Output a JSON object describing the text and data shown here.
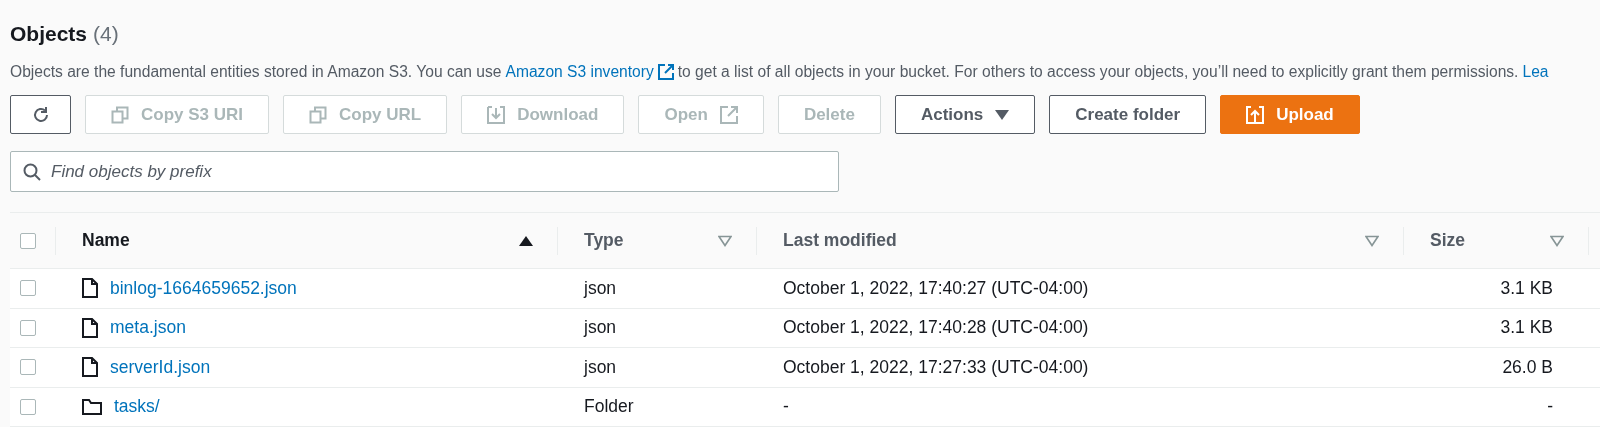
{
  "header": {
    "title": "Objects",
    "count": "(4)"
  },
  "description": {
    "text": "Objects are the fundamental entities stored in Amazon S3. You can use",
    "link": "Amazon S3 inventory",
    "after": "to get a list of all objects in your bucket. For others to access your objects, you’ll need to explicitly grant them permissions.",
    "more": "Lea"
  },
  "toolbar": [
    {
      "kind": "refresh",
      "disabled": false,
      "primary": false
    },
    {
      "kind": "copy",
      "label": "Copy S3 URI",
      "disabled": true,
      "primary": false
    },
    {
      "kind": "copy",
      "label": "Copy URL",
      "disabled": true,
      "primary": false
    },
    {
      "kind": "download",
      "label": "Download",
      "disabled": true,
      "primary": false
    },
    {
      "kind": "open",
      "label": "Open",
      "disabled": true,
      "primary": false
    },
    {
      "kind": "plain",
      "label": "Delete",
      "disabled": true,
      "primary": false
    },
    {
      "kind": "dropdown",
      "label": "Actions",
      "disabled": false,
      "primary": false
    },
    {
      "kind": "plain",
      "label": "Create folder",
      "disabled": false,
      "primary": false
    },
    {
      "kind": "upload",
      "label": "Upload",
      "disabled": false,
      "primary": true
    }
  ],
  "search": {
    "placeholder": "Find objects by prefix"
  },
  "table": {
    "select_all": {
      "checked": false
    },
    "columns": [
      {
        "label": "Name",
        "sorted": true
      },
      {
        "label": "Type",
        "sorted": false
      },
      {
        "label": "Last modified",
        "sorted": false
      },
      {
        "label": "Size",
        "sorted": false
      }
    ],
    "rows": [
      {
        "kind": "file",
        "checked": false,
        "name": "binlog-1664659652.json",
        "type": "json",
        "last_modified": "October 1, 2022, 17:40:27 (UTC-04:00)",
        "size": "3.1 KB"
      },
      {
        "kind": "file",
        "checked": false,
        "name": "meta.json",
        "type": "json",
        "last_modified": "October 1, 2022, 17:40:28 (UTC-04:00)",
        "size": "3.1 KB"
      },
      {
        "kind": "file",
        "checked": false,
        "name": "serverId.json",
        "type": "json",
        "last_modified": "October 1, 2022, 17:27:33 (UTC-04:00)",
        "size": "26.0 B"
      },
      {
        "kind": "folder",
        "checked": false,
        "name": "tasks/",
        "type": "Folder",
        "last_modified": "-",
        "size": "-"
      }
    ]
  }
}
